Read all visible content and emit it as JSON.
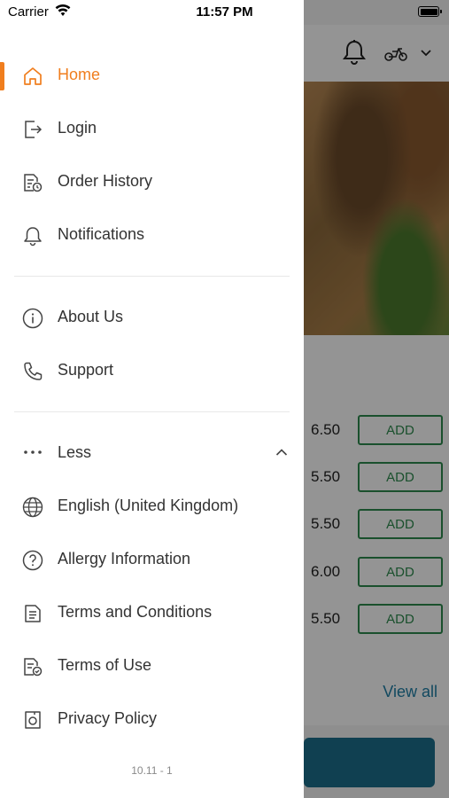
{
  "status_bar": {
    "carrier": "Carrier",
    "time": "11:57 PM"
  },
  "menu": {
    "primary": [
      {
        "label": "Home",
        "icon": "home-icon",
        "active": true
      },
      {
        "label": "Login",
        "icon": "login-icon"
      },
      {
        "label": "Order History",
        "icon": "order-history-icon"
      },
      {
        "label": "Notifications",
        "icon": "bell-icon"
      }
    ],
    "secondary": [
      {
        "label": "About Us",
        "icon": "info-icon"
      },
      {
        "label": "Support",
        "icon": "phone-icon"
      }
    ],
    "toggle": {
      "label": "Less",
      "icon": "more-dots-icon"
    },
    "more": [
      {
        "label": "English (United Kingdom)",
        "icon": "globe-icon"
      },
      {
        "label": "Allergy Information",
        "icon": "question-icon"
      },
      {
        "label": "Terms and Conditions",
        "icon": "document-icon"
      },
      {
        "label": "Terms of Use",
        "icon": "document-check-icon"
      },
      {
        "label": "Privacy Policy",
        "icon": "privacy-icon"
      }
    ],
    "version": "10.11 - 1",
    "accent_color": "#f07e1e"
  },
  "background": {
    "prices": [
      "6.50",
      "5.50",
      "5.50",
      "6.00",
      "5.50"
    ],
    "add_label": "ADD",
    "view_all": "View all",
    "accent_color": "#2e8a4e"
  }
}
